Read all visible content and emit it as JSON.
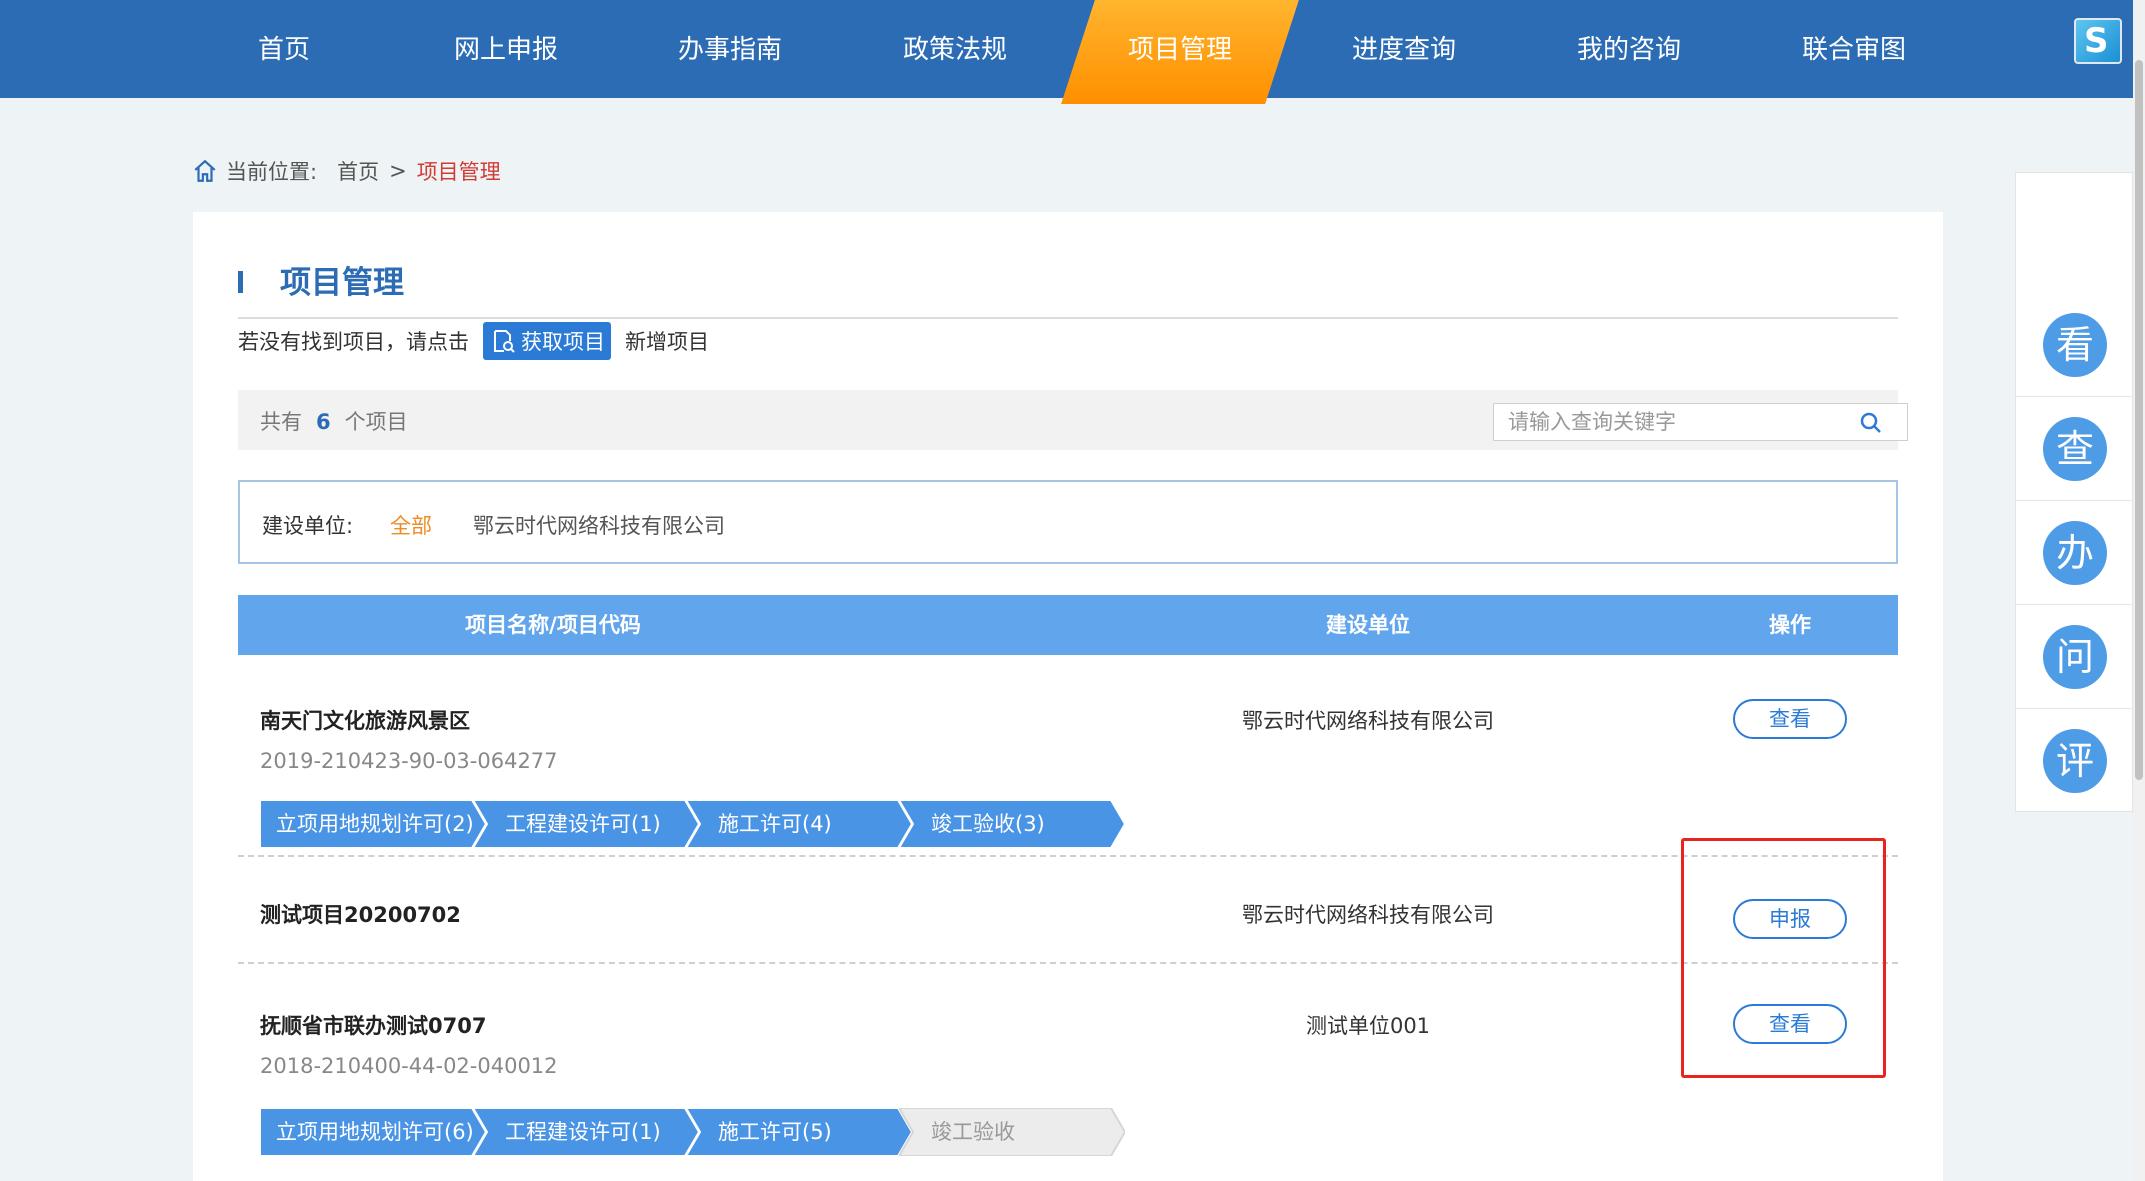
{
  "nav": {
    "items": [
      {
        "label": "首页"
      },
      {
        "label": "网上申报"
      },
      {
        "label": "办事指南"
      },
      {
        "label": "政策法规"
      },
      {
        "label": "项目管理"
      },
      {
        "label": "进度查询"
      },
      {
        "label": "我的咨询"
      },
      {
        "label": "联合审图"
      }
    ],
    "active_index": 4,
    "logo_letter": "S",
    "active_color": "#ff9a10",
    "bar_color": "#2b6cb5"
  },
  "breadcrumb": {
    "prefix": "当前位置:",
    "home": "首页",
    "sep": ">",
    "current": "项目管理"
  },
  "page_title": "项目管理",
  "hint": {
    "text": "若没有找到项目，请点击",
    "fetch_button": "获取项目",
    "add_link": "新增项目"
  },
  "summary": {
    "prefix": "共有",
    "count": "6",
    "suffix": "个项目"
  },
  "search": {
    "placeholder": "请输入查询关键字",
    "value": ""
  },
  "filter": {
    "label": "建设单位:",
    "all": "全部",
    "company": "鄂云时代网络科技有限公司"
  },
  "table": {
    "headers": {
      "name": "项目名称/项目代码",
      "unit": "建设单位",
      "op": "操作"
    },
    "rows": [
      {
        "name": "南天门文化旅游风景区",
        "code": "2019-210423-90-03-064277",
        "unit": "鄂云时代网络科技有限公司",
        "op": "查看",
        "steps": [
          "立项用地规划许可(2)",
          "工程建设许可(1)",
          "施工许可(4)",
          "竣工验收(3)"
        ]
      },
      {
        "name": "测试项目20200702",
        "unit": "鄂云时代网络科技有限公司",
        "op": "申报"
      },
      {
        "name": "抚顺省市联办测试0707",
        "code": "2018-210400-44-02-040012",
        "unit": "测试单位001",
        "op": "查看",
        "steps": [
          "立项用地规划许可(6)",
          "工程建设许可(1)",
          "施工许可(5)",
          "竣工验收"
        ]
      }
    ]
  },
  "sidebar": {
    "items": [
      "看",
      "查",
      "办",
      "问",
      "评"
    ]
  },
  "colors": {
    "step_active": "#4a94e6",
    "step_inactive": "#ececec",
    "highlight_box": "#e8241c"
  }
}
